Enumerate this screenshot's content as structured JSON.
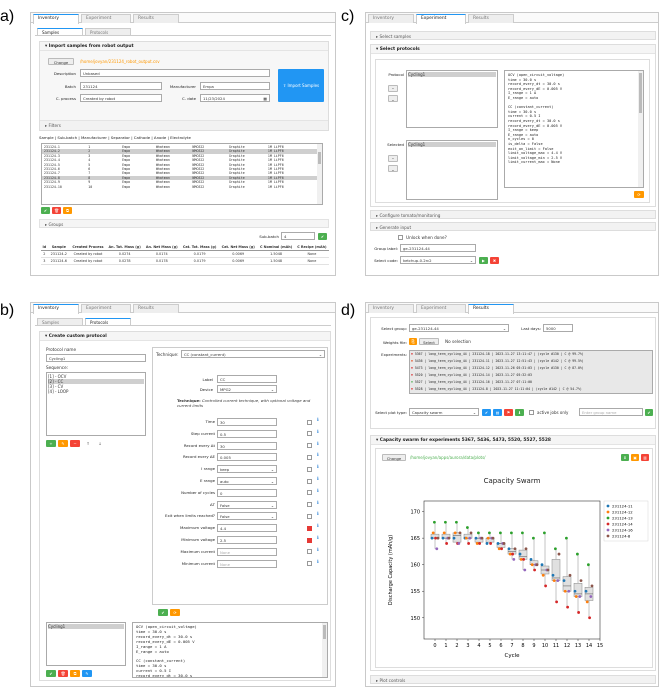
{
  "panel_labels": {
    "a": "a)",
    "b": "b)",
    "c": "c)",
    "d": "d)"
  },
  "tabs": {
    "inventory": "Inventory",
    "experiment": "Experiment",
    "results": "Results"
  },
  "a": {
    "subtabs": {
      "samples": "Samples",
      "protocols": "Protocols"
    },
    "import_header": "Import samples from robot output",
    "change_label": "Change",
    "file_path": "/home/jovyan/231124_robot_output.csv",
    "fields": {
      "description_label": "Description",
      "description_value": "Unbased",
      "batch_label": "Batch",
      "batch_value": "231124",
      "manufacturer_label": "Manufacturer",
      "manufacturer_value": "Empa",
      "cprocess_label": "C. process",
      "cprocess_value": "Created by robot",
      "cdate_label": "C. date",
      "cdate_value": "11/23/2024"
    },
    "import_button": "Import Samples",
    "filters_label": "Filters",
    "table_header": "Sample | Sub-batch | Manufacturer | Separator | Cathode | Anode | Electrolyte",
    "list_rows": [
      [
        "231124-1",
        "1",
        "Empa",
        "Whatman",
        "NMC622",
        "Graphite",
        "1M LiPF6"
      ],
      [
        "231124-2",
        "2",
        "Empa",
        "Whatman",
        "NMC622",
        "Graphite",
        "1M LiPF6"
      ],
      [
        "231124-3",
        "3",
        "Empa",
        "Whatman",
        "NMC622",
        "Graphite",
        "1M LiPF6"
      ],
      [
        "231124-4",
        "4",
        "Empa",
        "Whatman",
        "NMC622",
        "Graphite",
        "1M LiPF6"
      ],
      [
        "231124-5",
        "5",
        "Empa",
        "Whatman",
        "NMC622",
        "Graphite",
        "1M LiPF6"
      ],
      [
        "231124-6",
        "6",
        "Empa",
        "Whatman",
        "NMC622",
        "Graphite",
        "1M LiPF6"
      ],
      [
        "231124-7",
        "7",
        "Empa",
        "Whatman",
        "NMC622",
        "Graphite",
        "1M LiPF6"
      ],
      [
        "231124-8",
        "8",
        "Empa",
        "Whatman",
        "NMC622",
        "Graphite",
        "1M LiPF6"
      ],
      [
        "231124-9",
        "9",
        "Empa",
        "Whatman",
        "NMC622",
        "Graphite",
        "1M LiPF6"
      ],
      [
        "231124-10",
        "10",
        "Empa",
        "Whatman",
        "NMC622",
        "Graphite",
        "1M LiPF6"
      ]
    ],
    "groups_label": "Groups",
    "subbatch_label": "Sub-batch",
    "subbatch_value": "4",
    "result_cols": [
      "Id",
      "Sample",
      "Created Process",
      "An. Tot. Mass (g)",
      "An. Net Mass (g)",
      "Cat. Tot. Mass (g)",
      "Cat. Net Mass (g)",
      "C Nominal (mAh)",
      "C Recipe (mAh)"
    ],
    "result_rows": [
      [
        "2",
        "231124-2",
        "Created by robot",
        "0.0274",
        "0.0174",
        "0.0179",
        "0.0069",
        "1.5048",
        "None"
      ],
      [
        "3",
        "231124-6",
        "Created by robot",
        "0.0278",
        "0.0178",
        "0.0179",
        "0.0069",
        "1.5048",
        "None"
      ]
    ]
  },
  "b": {
    "subtabs": {
      "samples": "Samples",
      "protocols": "Protocols"
    },
    "header": "Create custom protocol",
    "protocol_name_label": "Protocol name",
    "protocol_name_value": "Cycling1",
    "sequence_label": "Sequence:",
    "sequence": [
      "[1] - OCV",
      "[2] - CC",
      "[3] - CV",
      "[4] - LOOP"
    ],
    "technique_label": "Technique:",
    "technique_value": "CC (constant_current)",
    "label_label": "Label",
    "label_value": "CC",
    "device_label": "Device",
    "device_value": "MPG2",
    "technique_desc_bold": "Technique:",
    "technique_desc": " Controlled current technique, with optional voltage and current limits",
    "params": [
      {
        "label": "Time",
        "value": "30"
      },
      {
        "label": "Step current",
        "value": "0.5"
      },
      {
        "label": "Record every Δt",
        "value": "30"
      },
      {
        "label": "Record every ΔE",
        "value": "0.005"
      },
      {
        "label": "I range",
        "value": "keep"
      },
      {
        "label": "E range",
        "value": "auto"
      },
      {
        "label": "Number of cycles",
        "value": "0"
      },
      {
        "label": "ΔT",
        "value": "False"
      },
      {
        "label": "Exit when limits reached?",
        "value": "False"
      },
      {
        "label": "Maximum voltage",
        "value": "4.4"
      },
      {
        "label": "Minimum voltage",
        "value": "2.5"
      },
      {
        "label": "Maximum current",
        "value": "None"
      },
      {
        "label": "Minimum current",
        "value": "None"
      }
    ],
    "bottom_list": "Cycling1",
    "code": "OCV (open_circuit_voltage)\ntime = 30.0 s\nrecord_every_dt = 30.0 s\nrecord_every_dE = 0.005 V\nI_range = 1 A\nE_range = auto\n\nCC (constant_current)\ntime = 30.0 s\ncurrent = 0.5 I\nrecord_every_dt = 30.0 s\nrecord_every_dE = 0.005 V\nI_range = keep\nE_range = auto"
  },
  "c": {
    "select_samples": "Select samples",
    "select_protocols": "Select protocols",
    "protocol_label": "Protocol",
    "protocol_item": "Cycling1",
    "selected_label": "Selected",
    "selected_item": "Cycling1",
    "code": "OCV (open_circuit_voltage)\ntime = 30.0 s\nrecord_every_dt = 30.0 s\nrecord_every_dE = 0.005 V\nI_range = 1 A\nE_range = auto\n\nCC (constant_current)\ntime = 30.0 s\ncurrent = 0.5 I\nrecord_every_dt = 30.0 s\nrecord_every_dE = 0.005 V\nI_range = keep\nE_range = auto\nn_cycles = 0\nis_delta = False\nexit_on_limit = False\nlimit_voltage_max = 4.4 V\nlimit_voltage_min = 2.5 V\nlimit_current_max = None",
    "configure": "Configure tomato/monitoring",
    "generate": "Generate input",
    "unlock_label": "Unlock when done?",
    "group_label": "Group label:",
    "group_value": "ge-231124-44",
    "select_code_label": "Select code:",
    "select_code_value": "ketchup-0.2rc2"
  },
  "d": {
    "select_group_label": "Select group:",
    "select_group_value": "ge-231124-44",
    "last_days_label": "Last days:",
    "last_days_value": "5000",
    "weights_label": "Weights file:",
    "select_btn": "Select",
    "no_selection": "No selection",
    "experiments_label": "Experiments:",
    "experiments": [
      "5367 | long_term_cycling_44 | 231124-18 | 2023-11-27 13:11:47 | (cycle #130 | C @ 99.7%)",
      "5436 | long_term_cycling_44 | 231124-11 | 2023-11-27 12:51:43 | (cycle #142 | C @ 99.5%)",
      "5473 | long_term_cycling_44 | 231124-12 | 2023-11-26 05:31:03 | (cycle #130 | C @ 87.0%)",
      "5520 | long_term_cycling_44 | 231124-14 | 2023-11-27 05:32:03",
      "5527 | long_term_cycling_44 | 231124-16 | 2023-11-27 07:11:00",
      "5528 | long_term_cycling_44 | 231124-8 | 2023-11-27 11:11:04 | (cycle #142 | C @ 54.7%)"
    ],
    "plot_type_label": "Select plot type:",
    "plot_type_value": "Capacity swarm",
    "active_only": "active jobs only",
    "group_name_placeholder": "Enter group name",
    "swarm_header": "Capacity swarm for experiments 5367, 5436, 5473, 5520, 5527, 5528",
    "change_label": "Change",
    "plot_path": "/home/jovyan/apps/aurora/data/plots/",
    "plot_controls": "Plot controls"
  },
  "chart_data": {
    "type": "scatter",
    "title": "Capacity Swarm",
    "xlabel": "Cycle",
    "ylabel": "Discharge Capacity (mAh/g)",
    "xlim": [
      -1,
      15
    ],
    "ylim": [
      146,
      172
    ],
    "x_ticks": [
      0,
      1,
      2,
      3,
      4,
      5,
      6,
      7,
      8,
      9,
      10,
      11,
      12,
      13,
      14,
      15
    ],
    "y_ticks": [
      150,
      155,
      160,
      165,
      170
    ],
    "legend_position": "top-right",
    "series": [
      {
        "name": "231124-11",
        "color": "#1f77b4",
        "values": [
          165,
          165,
          165,
          165,
          165,
          164,
          164,
          163,
          162,
          161,
          160,
          158,
          157,
          155,
          155
        ]
      },
      {
        "name": "231124-12",
        "color": "#ff7f0e",
        "values": [
          166,
          166,
          166,
          165,
          164,
          165,
          163,
          162,
          161,
          160,
          158,
          157,
          155,
          154,
          153
        ]
      },
      {
        "name": "231124-13",
        "color": "#2ca02c",
        "values": [
          168,
          168,
          168,
          167,
          166,
          166,
          166,
          166,
          166,
          165,
          166,
          163,
          165,
          162,
          160
        ]
      },
      {
        "name": "231124-14",
        "color": "#d62728",
        "values": [
          165,
          164,
          164,
          164,
          164,
          164,
          163,
          162,
          161,
          159,
          156,
          153,
          152,
          151,
          150
        ]
      },
      {
        "name": "231124-16",
        "color": "#9467bd",
        "values": [
          163,
          165,
          164,
          165,
          165,
          165,
          164,
          161,
          159,
          160,
          159,
          157,
          155,
          154,
          154
        ]
      },
      {
        "name": "231124-8",
        "color": "#8c564b",
        "values": [
          165,
          165,
          166,
          166,
          165,
          165,
          164,
          163,
          163,
          160,
          159,
          162,
          158,
          157,
          156
        ]
      }
    ]
  }
}
